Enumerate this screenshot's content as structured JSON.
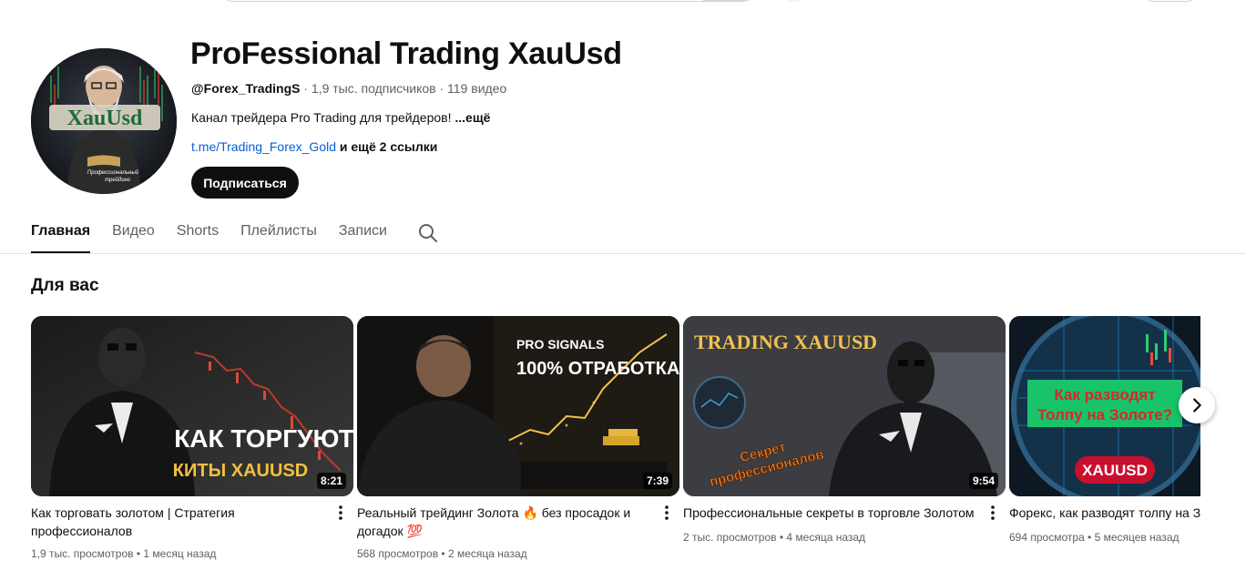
{
  "channel": {
    "title": "ProFessional Trading XauUsd",
    "handle": "@Forex_TradingS",
    "stats": " · 1,9 тыс. подписчиков · 119 видео",
    "description": "Канал трейдера Pro Trading для трейдеров! ",
    "description_more": "...ещё",
    "link": "t.me/Trading_Forex_Gold",
    "more_links": " и ещё 2 ссылки",
    "subscribe_label": "Подписаться",
    "avatar_text": "XauUsd",
    "avatar_caption_1": "Профессиональный",
    "avatar_caption_2": "трейдинг"
  },
  "tabs": [
    {
      "label": "Главная",
      "active": true
    },
    {
      "label": "Видео"
    },
    {
      "label": "Shorts"
    },
    {
      "label": "Плейлисты"
    },
    {
      "label": "Записи"
    }
  ],
  "section_title": "Для вас",
  "videos": [
    {
      "title": "Как торговать золотом | Стратегия профессионалов",
      "views": "1,9 тыс. просмотров",
      "age": "1 месяц назад",
      "duration": "8:21",
      "thumb_text_1": "КАК ТОРГУЮТ",
      "thumb_text_2": "КИТЫ XAUUSD"
    },
    {
      "title": "Реальный трейдинг Золота 🔥 без просадок и догадок 💯",
      "views": "568 просмотров",
      "age": "2 месяца назад",
      "duration": "7:39",
      "thumb_text_1": "PRO SIGNALS",
      "thumb_text_2": "100% ОТРАБОТКА"
    },
    {
      "title": "Профессиональные секреты в торговле Золотом",
      "views": "2 тыс. просмотров",
      "age": "4 месяца назад",
      "duration": "9:54",
      "thumb_text_1": "TRADING XAUUSD",
      "thumb_text_2": "Секрет",
      "thumb_text_3": "профессионалов"
    },
    {
      "title": "Форекс, как разводят толпу на Золоте",
      "views": "694 просмотра",
      "age": "5 месяцев назад",
      "thumb_text_1": "Как разводят",
      "thumb_text_2": "Толпу на Золоте?",
      "thumb_text_3": "XAUUSD"
    }
  ],
  "meta_separator": " • ",
  "icons": {
    "search": "search-icon",
    "menu": "more-vert-icon",
    "next": "chevron-right-icon"
  }
}
